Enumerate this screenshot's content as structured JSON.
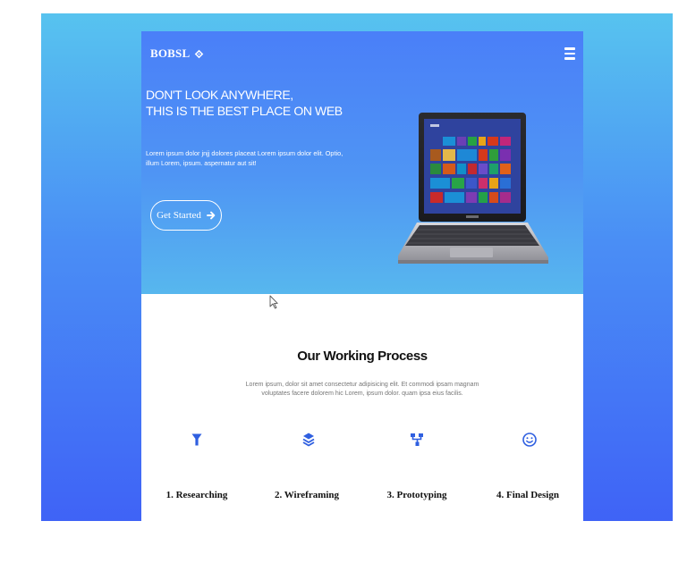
{
  "brand": {
    "name": "BOBSL",
    "icon": "tag-icon"
  },
  "nav": {
    "menu_icon": "hamburger-icon"
  },
  "hero": {
    "headline_line1": "DON'T LOOK ANYWHERE,",
    "headline_line2": "THIS IS THE BEST PLACE ON WEB",
    "description_line1": "Lorem ipsum dolor jnjj dolores placeat Lorem ipsum dolor elit. Optio,",
    "description_line2": "illum Lorem, ipsum. aspernatur aut sit!",
    "cta_label": "Get Started",
    "cta_icon": "arrow-right-icon",
    "image": "laptop-image"
  },
  "process": {
    "title": "Our Working Process",
    "description_line1": "Lorem ipsum, dolor sit amet consectetur adipisicing elit. Et commodi ipsam magnam",
    "description_line2": "voluptates facere dolorem hic Lorem, ipsum dolor. quam ipsa eius facilis.",
    "steps": [
      {
        "label": "1. Researching",
        "icon": "funnel-icon"
      },
      {
        "label": "2. Wireframing",
        "icon": "layers-icon"
      },
      {
        "label": "3. Prototyping",
        "icon": "sitemap-icon"
      },
      {
        "label": "4. Final Design",
        "icon": "smiley-icon"
      }
    ]
  },
  "colors": {
    "outer_top": "#57c3ef",
    "outer_bottom": "#3f63f6",
    "hero_top": "#4a7ff8",
    "hero_bottom": "#57b7ee",
    "icon_blue": "#2f5fe0"
  }
}
